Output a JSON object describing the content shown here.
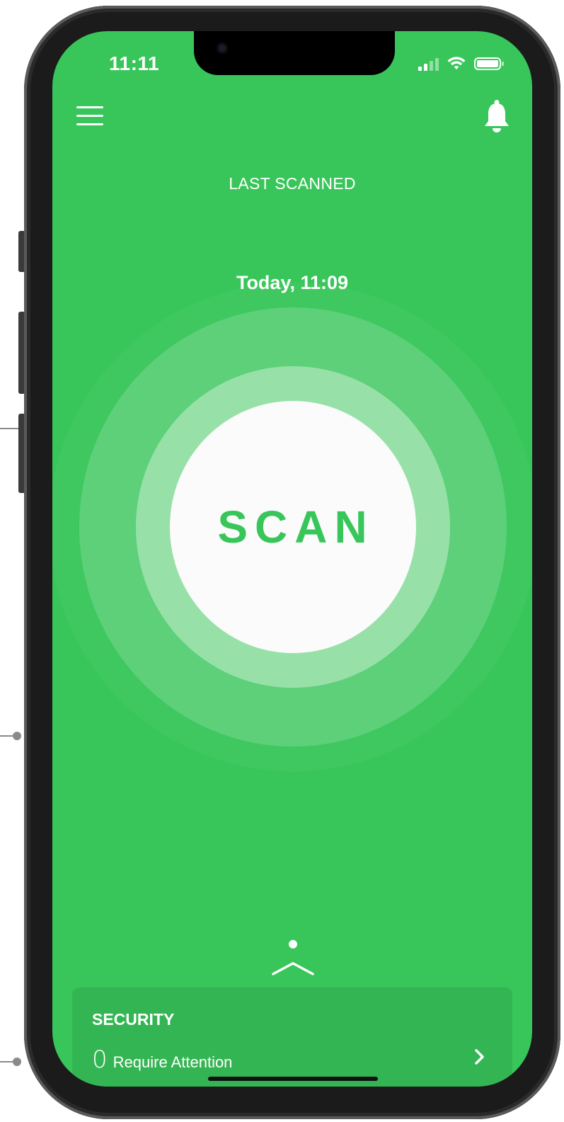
{
  "status_bar": {
    "time": "11:11"
  },
  "header": {
    "menu_icon": "hamburger-menu-icon",
    "notification_icon": "bell-icon"
  },
  "last_scan": {
    "label": "LAST SCANNED",
    "value": "Today, 11:09"
  },
  "scan_button": {
    "label": "SCAN"
  },
  "security": {
    "title": "SECURITY",
    "count": "0",
    "status_text": "Require Attention"
  },
  "colors": {
    "brand_green": "#38c65a",
    "card_green": "#34b553",
    "white": "#ffffff"
  }
}
